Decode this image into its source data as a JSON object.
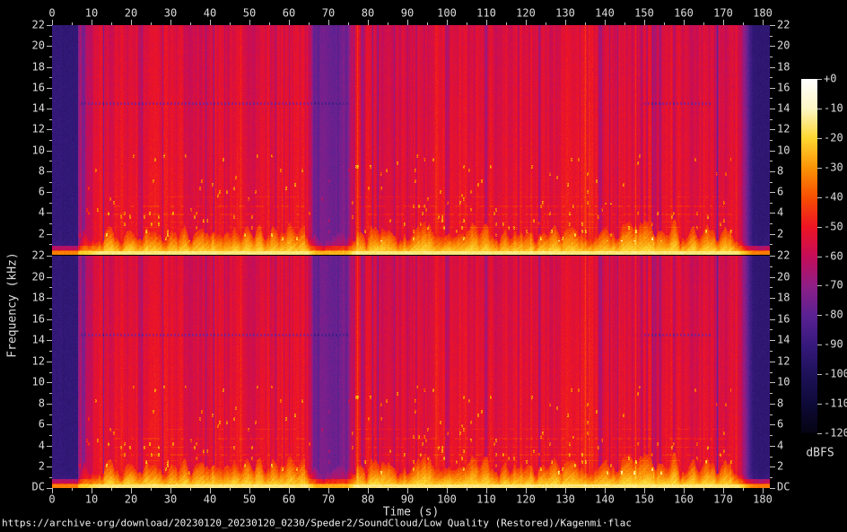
{
  "figure": {
    "caption": "https://archive·org/download/20230120_20230120_0230/Speder2/SoundCloud/Low Quality (Restored)/Kagenmi·flac",
    "background": "#000000",
    "text_color": "#dcdcdc"
  },
  "chart_data": {
    "type": "heatmap",
    "subtype": "audio-spectrogram",
    "channels": 2,
    "channel_names": [
      "channel-1",
      "channel-2"
    ],
    "x": {
      "label": "Time (s)",
      "unit": "s",
      "min": 0,
      "max": 180,
      "major_ticks": [
        0,
        10,
        20,
        30,
        40,
        50,
        60,
        70,
        80,
        90,
        100,
        110,
        120,
        130,
        140,
        150,
        160,
        170,
        180
      ],
      "minor_ticks": [
        5,
        15,
        25,
        35,
        45,
        55,
        65,
        75,
        85,
        95,
        105,
        115,
        125,
        135,
        145,
        155,
        165,
        175
      ]
    },
    "y": {
      "label": "Frequency (kHz)",
      "unit": "kHz",
      "max": 22,
      "dc_label": "DC",
      "major_ticks": [
        22,
        20,
        18,
        16,
        14,
        12,
        10,
        8,
        6,
        4,
        2
      ],
      "minor_ticks": [
        21,
        19,
        17,
        15,
        13,
        11,
        9,
        7,
        5,
        3,
        1
      ]
    },
    "colorbar": {
      "label": "dBFS",
      "min": -120,
      "max": 0,
      "ticks": [
        {
          "label": "+0",
          "db": 0
        },
        {
          "label": "-10",
          "db": -10
        },
        {
          "label": "-20",
          "db": -20
        },
        {
          "label": "-30",
          "db": -30
        },
        {
          "label": "-40",
          "db": -40
        },
        {
          "label": "-50",
          "db": -50
        },
        {
          "label": "-60",
          "db": -60
        },
        {
          "label": "-70",
          "db": -70
        },
        {
          "label": "-80",
          "db": -80
        },
        {
          "label": "-90",
          "db": -90
        },
        {
          "label": "-100",
          "db": -100
        },
        {
          "label": "-110",
          "db": -110
        },
        {
          "label": "-120",
          "db": -120
        }
      ],
      "palette": [
        {
          "db": 0,
          "color": "#ffffff"
        },
        {
          "db": -10,
          "color": "#fdf6c4"
        },
        {
          "db": -20,
          "color": "#fdd62f"
        },
        {
          "db": -30,
          "color": "#fb9306"
        },
        {
          "db": -40,
          "color": "#f64e02"
        },
        {
          "db": -50,
          "color": "#ee1424"
        },
        {
          "db": -60,
          "color": "#c40d58"
        },
        {
          "db": -70,
          "color": "#8e1e86"
        },
        {
          "db": -80,
          "color": "#5a2192"
        },
        {
          "db": -90,
          "color": "#36197c"
        },
        {
          "db": -100,
          "color": "#1d1158"
        },
        {
          "db": -110,
          "color": "#0d0a38"
        },
        {
          "db": -120,
          "color": "#050310"
        }
      ]
    },
    "features": {
      "description": "Stereo spectrogram, both channels nearly identical. Dominant broadband red energy (~-50 dBFS) with fine vertical striation, bright yellow bass band below ~2 kHz, quiet dark intro 0-6.5 s, purple fade-in 6.5-12 s, quiet purple breakdown ~67-75 s, dense purple striping ~150-173 s, dark outro fade after ~174 s, faint dark notch line near 14.5 kHz.",
      "base_level_db": -50.5,
      "regions": [
        {
          "t0": 0,
          "t1": 6.5,
          "atten": 0.86,
          "ramp": "none",
          "desc": "quiet intro"
        },
        {
          "t0": 6.5,
          "t1": 12,
          "atten": 0.42,
          "ramp": "out",
          "desc": "fade-in"
        },
        {
          "t0": 64.5,
          "t1": 66.8,
          "atten": 0.5,
          "ramp": "in",
          "desc": "into breakdown"
        },
        {
          "t0": 66.8,
          "t1": 74.6,
          "atten": 0.5,
          "ramp": "none",
          "desc": "quiet breakdown"
        },
        {
          "t0": 74.6,
          "t1": 76.4,
          "atten": 0.5,
          "ramp": "out",
          "desc": "out of breakdown"
        },
        {
          "t0": 173.5,
          "t1": 177.5,
          "atten": 0.88,
          "ramp": "in",
          "desc": "outro fade"
        },
        {
          "t0": 177.5,
          "t1": 182.5,
          "atten": 0.88,
          "ramp": "none",
          "desc": "outro tail"
        }
      ],
      "stripe_zones": [
        {
          "t0": 11,
          "t1": 32,
          "boost": 0.05
        },
        {
          "t0": 149,
          "t1": 173.5,
          "boost": 0.09
        }
      ],
      "hlines": [
        {
          "f": 14.55,
          "t0": 7,
          "t1": 75,
          "depth_db": 15
        },
        {
          "f": 14.55,
          "t0": 150,
          "t1": 167,
          "depth_db": 15
        }
      ],
      "tones_khz": [
        2.65,
        3.2,
        3.9,
        4.7,
        5.6
      ],
      "transients_s": [
        7.1,
        40.6,
        73.7,
        77.3,
        104.6,
        121.2,
        135.0,
        147.7,
        152.3
      ]
    }
  }
}
